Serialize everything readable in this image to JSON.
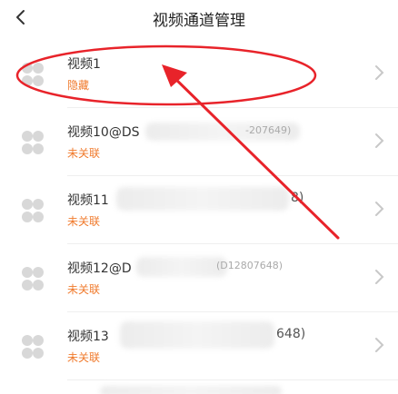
{
  "header": {
    "title": "视频通道管理",
    "back_icon": "chevron-left-icon"
  },
  "channels": [
    {
      "name": "视频1",
      "status": "隐藏",
      "name_tail": ""
    },
    {
      "name": "视频10@DS",
      "status": "未关联",
      "name_tail": "-207649)"
    },
    {
      "name": "视频11",
      "status": "未关联",
      "name_tail": "8)"
    },
    {
      "name": "视频12@D",
      "status": "未关联",
      "name_tail": "(D12807648)"
    },
    {
      "name": "视频13",
      "status": "未关联",
      "name_tail": "648)"
    }
  ],
  "colors": {
    "status_text": "#f07a2c",
    "annotation_red": "#e8232a",
    "icon_grey": "#d8d8d8",
    "chevron_grey": "#c8c8c8"
  },
  "icons": {
    "row_icon": "video-channel-icon",
    "row_chevron": "chevron-right-icon"
  }
}
